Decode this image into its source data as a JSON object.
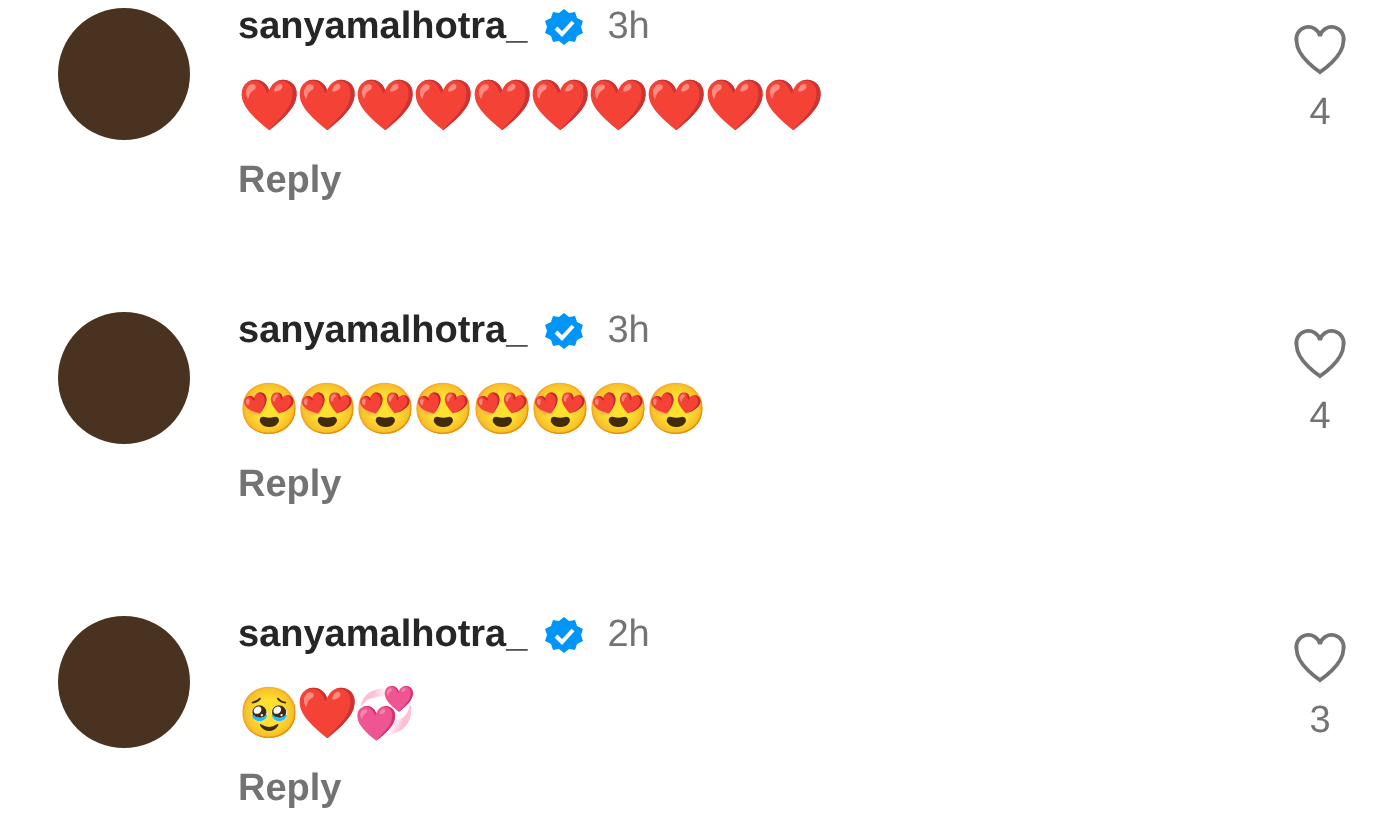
{
  "comments": [
    {
      "username": "sanyamalhotra_",
      "verified": true,
      "time": "3h",
      "text": "❤️❤️❤️❤️❤️❤️❤️❤️❤️❤️",
      "reply": "Reply",
      "liked": false,
      "likes": "4"
    },
    {
      "username": "sanyamalhotra_",
      "verified": true,
      "time": "3h",
      "text": "😍😍😍😍😍😍😍😍",
      "reply": "Reply",
      "liked": false,
      "likes": "4"
    },
    {
      "username": "sanyamalhotra_",
      "verified": true,
      "time": "2h",
      "text": "🥹❤️💞",
      "reply": "Reply",
      "liked": false,
      "likes": "3"
    }
  ]
}
